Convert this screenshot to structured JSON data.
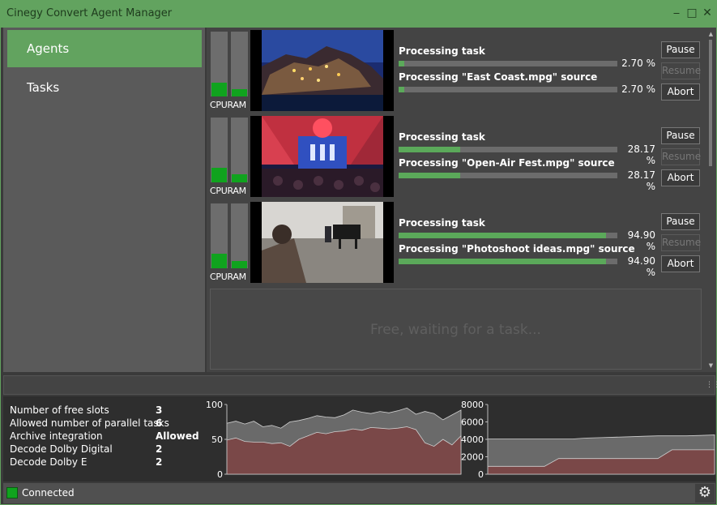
{
  "window": {
    "title": "Cinegy Convert Agent Manager"
  },
  "nav": {
    "agents": "Agents",
    "tasks": "Tasks"
  },
  "agents": [
    {
      "cpu": 0.21,
      "ram": 0.11,
      "task_label": "Processing task",
      "task_pct": "2.70 %",
      "task_value": 0.027,
      "source_label": "Processing \"East Coast.mpg\" source",
      "source_pct": "2.70 %",
      "source_value": 0.027
    },
    {
      "cpu": 0.23,
      "ram": 0.12,
      "task_label": "Processing task",
      "task_pct": "28.17 %",
      "task_value": 0.2817,
      "source_label": "Processing \"Open-Air Fest.mpg\" source",
      "source_pct": "28.17 %",
      "source_value": 0.2817
    },
    {
      "cpu": 0.22,
      "ram": 0.11,
      "task_label": "Processing task",
      "task_pct": "94.90 %",
      "task_value": 0.949,
      "source_label": "Processing \"Photoshoot ideas.mpg\" source",
      "source_pct": "94.90 %",
      "source_value": 0.949
    }
  ],
  "labels": {
    "cpu": "CPU",
    "ram": "RAM",
    "pause": "Pause",
    "resume": "Resume",
    "abort": "Abort"
  },
  "free_slot": "Free, waiting for a task...",
  "stats": [
    {
      "label": "Number of free slots",
      "value": "3"
    },
    {
      "label": "Allowed number of parallel tasks",
      "value": "6"
    },
    {
      "label": "Archive integration",
      "value": "Allowed"
    },
    {
      "label": "Decode Dolby Digital",
      "value": "2"
    },
    {
      "label": "Decode Dolby E",
      "value": "2"
    }
  ],
  "status": {
    "text": "Connected"
  },
  "colors": {
    "accent": "#62a35f",
    "meter": "#10a31e",
    "chart_top": "#6a6a6a",
    "chart_bottom": "#7a4848"
  },
  "icons": {
    "minimize": "minimize-icon",
    "maximize": "maximize-icon",
    "close": "close-icon",
    "settings": "gear-icon",
    "grid": "grip-icon"
  },
  "chart_data": [
    {
      "type": "area",
      "ylim": [
        0,
        100
      ],
      "yticks": [
        "100",
        "50",
        "0"
      ],
      "series": [
        {
          "values": [
            73,
            76,
            72,
            76,
            68,
            70,
            66,
            75,
            77,
            80,
            84,
            82,
            81,
            85,
            92,
            89,
            87,
            90,
            88,
            91,
            95,
            86,
            90,
            87,
            78,
            85,
            92
          ]
        },
        {
          "values": [
            49,
            52,
            47,
            46,
            46,
            44,
            45,
            40,
            50,
            55,
            60,
            58,
            61,
            62,
            65,
            63,
            67,
            66,
            65,
            66,
            68,
            64,
            45,
            40,
            50,
            42,
            55
          ]
        }
      ]
    },
    {
      "type": "area",
      "ylim": [
        0,
        8000
      ],
      "yticks": [
        "8000",
        "6000",
        "4000",
        "2000",
        "0"
      ],
      "series": [
        {
          "values": [
            4050,
            4050,
            4050,
            4050,
            4050,
            4050,
            4050,
            4150,
            4200,
            4250,
            4300,
            4350,
            4400,
            4400,
            4400,
            4450,
            4500
          ]
        },
        {
          "values": [
            900,
            900,
            900,
            900,
            900,
            1800,
            1800,
            1800,
            1800,
            1800,
            1800,
            1800,
            1800,
            2800,
            2800,
            2800,
            2800
          ]
        }
      ]
    }
  ]
}
